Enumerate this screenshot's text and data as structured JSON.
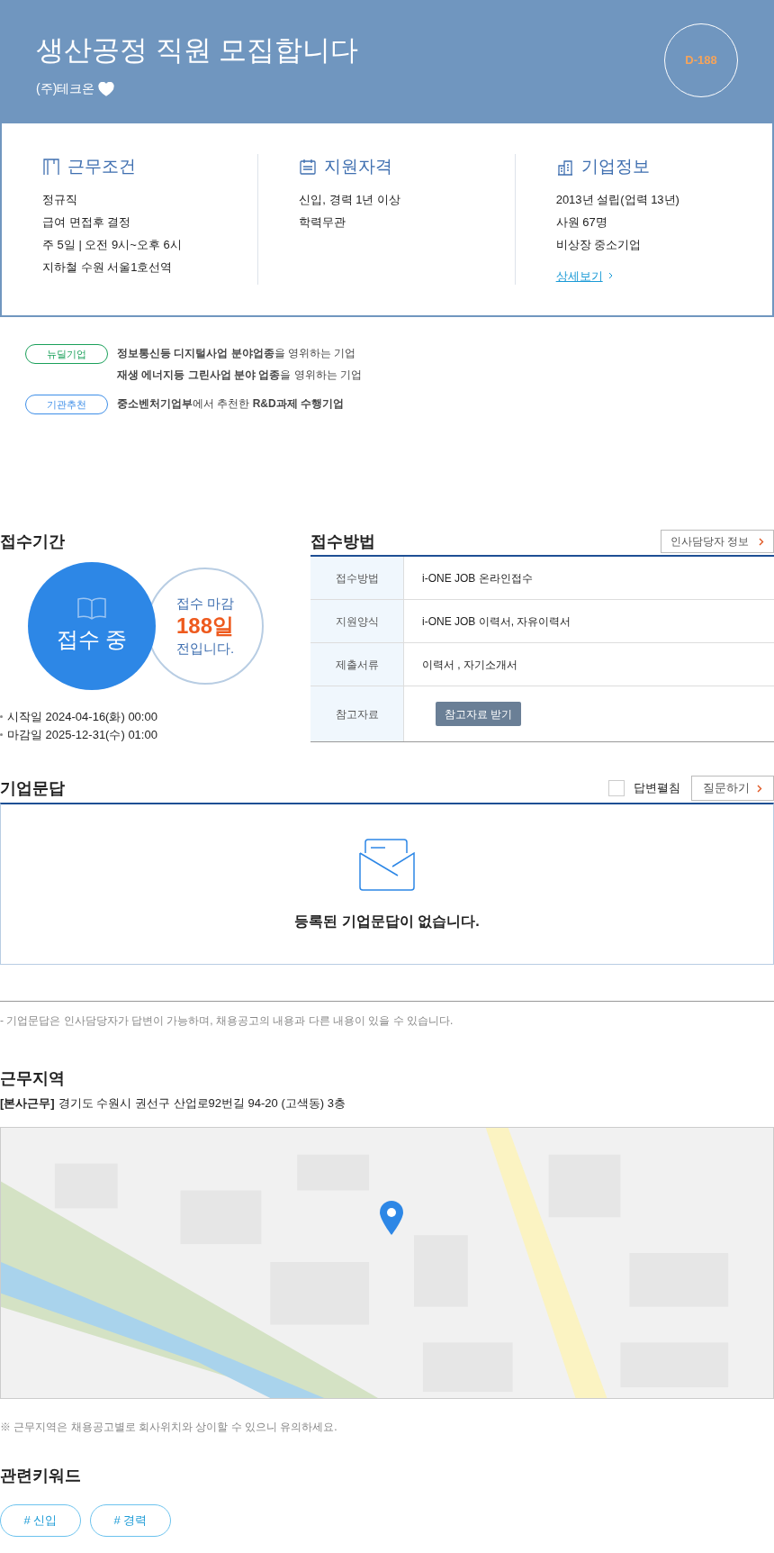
{
  "header": {
    "title": "생산공정 직원 모집합니다",
    "company": "(주)테크온",
    "favorite": true,
    "dday": "D-188"
  },
  "summary": [
    {
      "title": "근무조건",
      "lines": [
        "정규직",
        "급여 면접후 결정",
        "주 5일 | 오전 9시~오후 6시",
        "지하철 수원 서울1호선역"
      ]
    },
    {
      "title": "지원자격",
      "lines": [
        "신입, 경력 1년 이상",
        "학력무관"
      ]
    },
    {
      "title": "기업정보",
      "lines": [
        "2013년 설립(업력 13년)",
        "사원 67명",
        "비상장 중소기업"
      ],
      "link": "상세보기"
    }
  ],
  "badges": [
    {
      "label": "뉴딜기업",
      "color": "#1aa05a",
      "lines": [
        "**정보통신등 디지털사업 분야업종**을 영위하는 기업",
        "**재생 에너지등 그린사업 분야 업종**을 영위하는 기업"
      ]
    },
    {
      "label": "기관추천",
      "color": "#3d8ee8",
      "lines": [
        "**중소벤처기업부**에서 추천한 **R&D과제 수행기업**"
      ]
    }
  ],
  "period": {
    "title": "접수기간",
    "status": "접수 중",
    "deadline_label": "접수 마감",
    "days": "188일",
    "suffix": "전입니다.",
    "dates": [
      "시작일 2024-04-16(화) 00:00",
      "마감일 2025-12-31(수) 01:00"
    ]
  },
  "method": {
    "title": "접수방법",
    "contact_button": "인사담당자 정보",
    "rows": [
      {
        "label": "접수방법",
        "value": "i-ONE JOB 온라인접수",
        "kind": "text"
      },
      {
        "label": "지원양식",
        "value": "i-ONE JOB 이력서, 자유이력서",
        "kind": "text"
      },
      {
        "label": "제출서류",
        "value": "이력서 , 자기소개서",
        "kind": "text"
      },
      {
        "label": "참고자료",
        "value": "참고자료 받기",
        "kind": "button"
      }
    ]
  },
  "qa": {
    "title": "기업문답",
    "toggle_label": "답변펼침",
    "toggle_checked": false,
    "ask_button": "질문하기",
    "empty": "등록된 기업문답이 없습니다.",
    "note": "- 기업문답은 인사담당자가 답변이 가능하며, 채용공고의 내용과 다른 내용이 있을 수 있습니다."
  },
  "location": {
    "title": "근무지역",
    "tag": "[본사근무]",
    "address": "경기도 수원시 권선구 산업로92번길 94-20 (고색동) 3층",
    "note": "※ 근무지역은 채용공고별로 회사위치와 상이할 수 있으니 유의하세요."
  },
  "keywords": {
    "title": "관련키워드",
    "items": [
      "# 신입",
      "# 경력"
    ]
  }
}
